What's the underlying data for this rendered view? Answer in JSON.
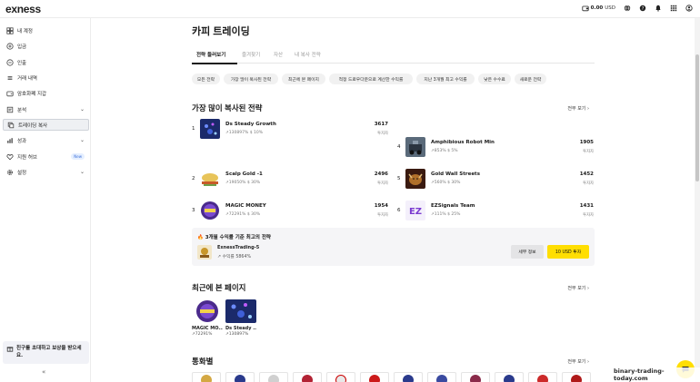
{
  "app": {
    "logo": "exness",
    "balance_value": "0.00",
    "balance_currency": "USD"
  },
  "sidebar": {
    "items": [
      {
        "label": "내 계정",
        "icon": "grid-icon"
      },
      {
        "label": "입금",
        "icon": "plus-circle-icon"
      },
      {
        "label": "인출",
        "icon": "minus-circle-icon"
      },
      {
        "label": "거래 내역",
        "icon": "list-icon"
      },
      {
        "label": "암호화폐 지갑",
        "icon": "wallet-icon"
      },
      {
        "label": "분석",
        "icon": "analytics-icon"
      },
      {
        "label": "트레이딩 복사",
        "icon": "copy-icon"
      },
      {
        "label": "성과",
        "icon": "chart-icon"
      },
      {
        "label": "지원 허브",
        "icon": "heart-icon"
      },
      {
        "label": "설정",
        "icon": "gear-icon"
      }
    ],
    "new_badge": "New",
    "invite_text": "친구를 초대하고 보상을 받으세요.",
    "collapse_label": "«"
  },
  "main": {
    "title": "카피 트레이딩",
    "tabs": [
      "전략 둘러보기",
      "즐겨찾기",
      "자산",
      "내 복사 전략"
    ],
    "chips": [
      "모든 전략",
      "가장 많이 복사된 전략",
      "최근에 본 페이지",
      "적정 드로우다운으로 계산한 수익률",
      "지난 3개월 최고 수익률",
      "낮은 수수료",
      "새로운 전략"
    ],
    "most_copied": {
      "title": "가장 많이 복사된 전략",
      "see_all": "전부 보기",
      "investor_label": "투자자",
      "strategies": [
        {
          "rank": "1",
          "name": "Ds Steady Growth",
          "return": "130897%",
          "fee": "10%",
          "investors": "3617"
        },
        {
          "rank": "2",
          "name": "Scalp Gold -1",
          "return": "19050%",
          "fee": "30%",
          "investors": "2496"
        },
        {
          "rank": "3",
          "name": "MAGIC MONEY",
          "return": "72291%",
          "fee": "30%",
          "investors": "1954"
        },
        {
          "rank": "4",
          "name": "Amphibious Robot Min",
          "return": "853%",
          "fee": "5%",
          "investors": "1905"
        },
        {
          "rank": "5",
          "name": "Gold Wall Streets",
          "return": "560%",
          "fee": "30%",
          "investors": "1452"
        },
        {
          "rank": "6",
          "name": "EZSignals Team",
          "return": "111%",
          "fee": "25%",
          "investors": "1431"
        }
      ]
    },
    "best": {
      "title": "3개월 수익률 기준 최고의 전략",
      "name": "ExnessTrading-5",
      "meta": "수익률 5864%",
      "detail_button": "세부 정보",
      "invest_button": "10 USD 투자"
    },
    "recent": {
      "title": "최근에 본 페이지",
      "see_all": "전부 보기",
      "items": [
        {
          "name": "MAGIC MO...",
          "return": "72291%"
        },
        {
          "name": "Ds Steady ...",
          "return": "130897%"
        }
      ]
    },
    "currency": {
      "title": "통화별",
      "see_all": "전부 보기"
    }
  },
  "watermark": "binary-trading-today.com"
}
